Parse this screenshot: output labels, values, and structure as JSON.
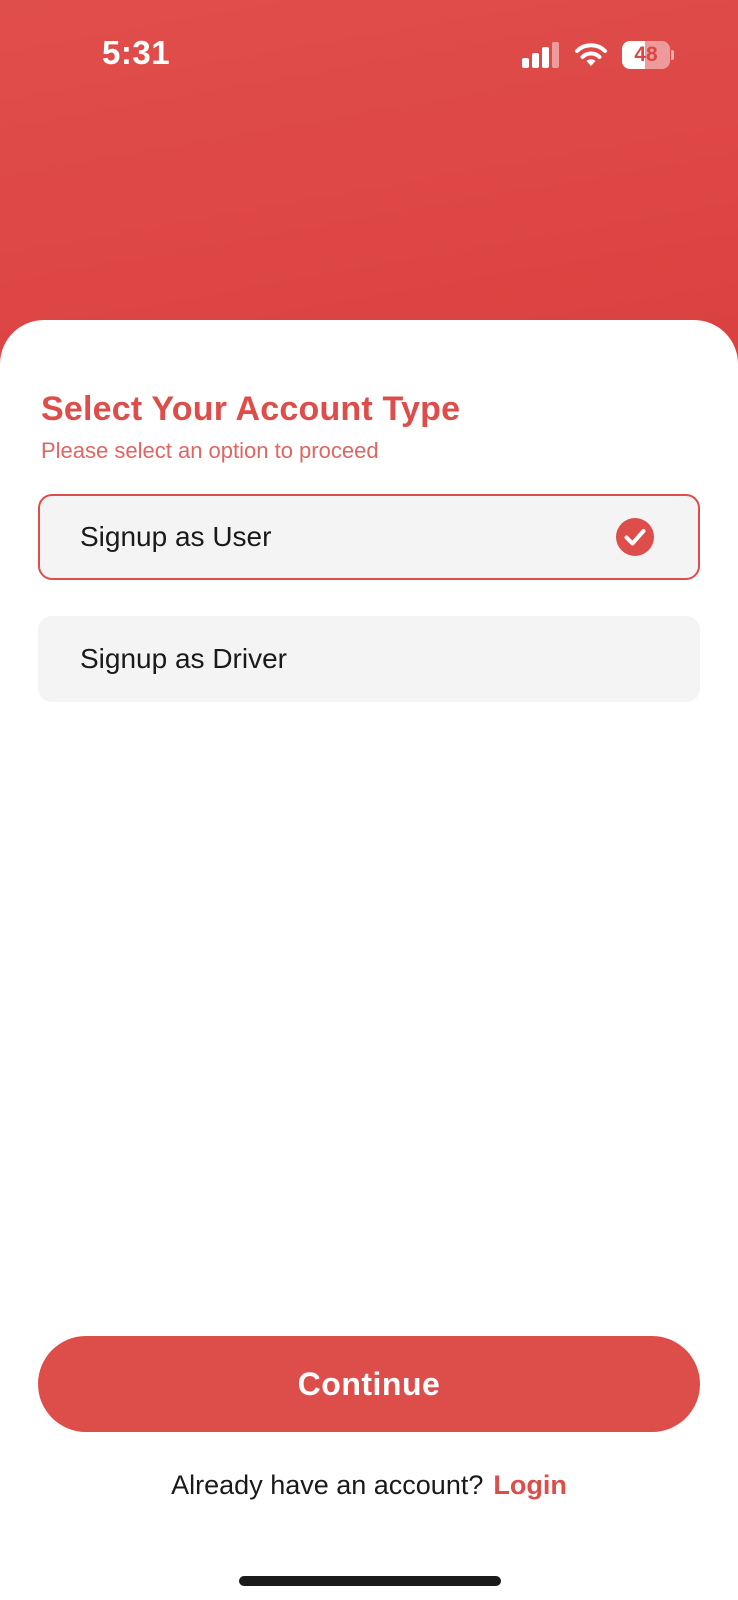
{
  "status_bar": {
    "time": "5:31",
    "battery_percent": "48",
    "battery_level": 0.48
  },
  "header": {
    "title": "Select Your Account Type",
    "subtitle": "Please select an option to proceed"
  },
  "options": [
    {
      "label": "Signup as User",
      "selected": true
    },
    {
      "label": "Signup as Driver",
      "selected": false
    }
  ],
  "actions": {
    "continue_label": "Continue",
    "login_prompt": "Already have an account?",
    "login_label": "Login"
  },
  "icons": {
    "status": [
      "cellular-signal-icon",
      "wifi-icon",
      "battery-icon"
    ],
    "selected_option": "check-circle-icon"
  },
  "colors": {
    "brand": "#dd4d4a",
    "option_background": "#f4f4f4",
    "text": "#1a1a1a"
  }
}
